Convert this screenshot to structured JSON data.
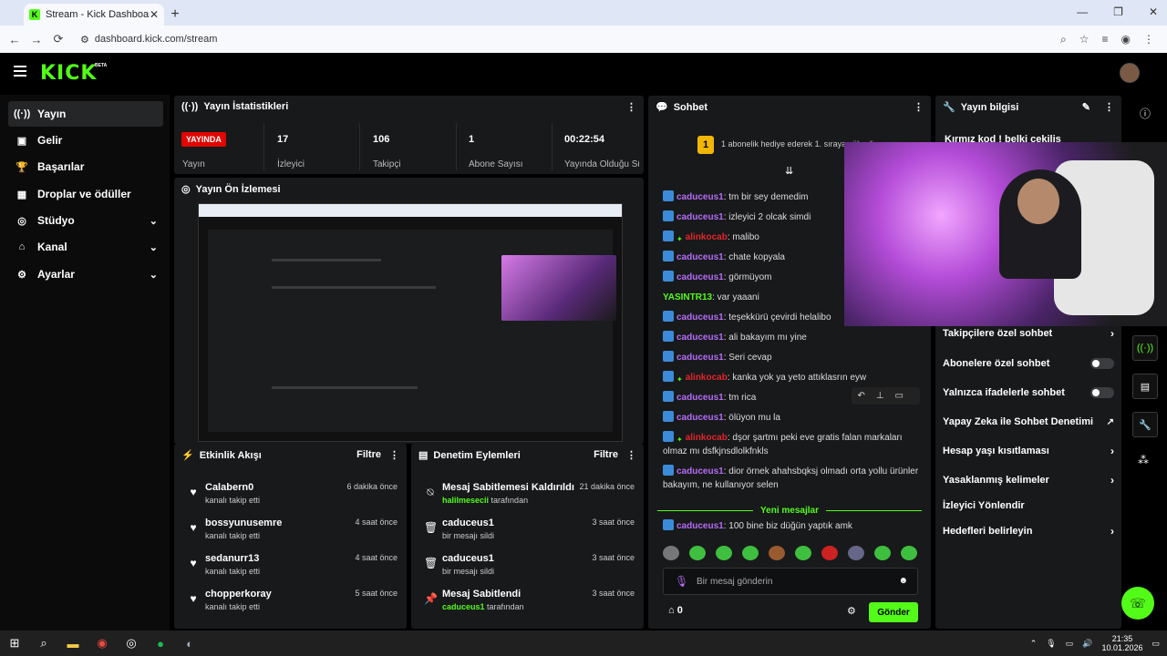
{
  "browser": {
    "tab_title": "Stream - Kick Dashboard",
    "url": "dashboard.kick.com/stream"
  },
  "header": {
    "logo": "KICK",
    "beta": "BETA"
  },
  "sidebar": {
    "items": [
      {
        "label": "Yayın",
        "icon": "broadcast-icon"
      },
      {
        "label": "Gelir",
        "icon": "revenue-icon"
      },
      {
        "label": "Başarılar",
        "icon": "trophy-icon"
      },
      {
        "label": "Droplar ve ödüller",
        "icon": "gift-icon"
      },
      {
        "label": "Stüdyo",
        "icon": "studio-icon"
      },
      {
        "label": "Kanal",
        "icon": "channel-icon"
      },
      {
        "label": "Ayarlar",
        "icon": "gear-icon"
      }
    ]
  },
  "stats": {
    "title": "Yayın İstatistikleri",
    "live": "YAYINDA",
    "stream_label": "Yayın",
    "viewers": "17",
    "viewers_label": "İzleyici",
    "followers": "106",
    "followers_label": "Takipçi",
    "subs": "1",
    "subs_label": "Abone Sayısı",
    "uptime": "00:22:54",
    "uptime_label": "Yayında Olduğu Süre"
  },
  "preview": {
    "title": "Yayın Ön İzlemesi"
  },
  "activity": {
    "title": "Etkinlik Akışı",
    "filter": "Filtre",
    "items": [
      {
        "name": "Calabern0",
        "sub": "kanalı takip etti",
        "time": "6 dakika önce"
      },
      {
        "name": "bossyunusemre",
        "sub": "kanalı takip etti",
        "time": "4 saat önce"
      },
      {
        "name": "sedanurr13",
        "sub": "kanalı takip etti",
        "time": "4 saat önce"
      },
      {
        "name": "chopperkoray",
        "sub": "kanalı takip etti",
        "time": "5 saat önce"
      }
    ]
  },
  "moderation": {
    "title": "Denetim Eylemleri",
    "filter": "Filtre",
    "items": [
      {
        "name": "Mesaj Sabitlemesi Kaldırıldı",
        "by": "halilmesecii",
        "sub": "tarafından",
        "time": "21 dakika önce"
      },
      {
        "name": "caduceus1",
        "sub": "bir mesajı sildi",
        "time": "3 saat önce"
      },
      {
        "name": "caduceus1",
        "sub": "bir mesajı sildi",
        "time": "3 saat önce"
      },
      {
        "name": "Mesaj Sabitlendi",
        "by": "caduceus1",
        "sub": "tarafından",
        "time": "3 saat önce"
      }
    ]
  },
  "chat": {
    "title": "Sohbet",
    "gift_banner": "1 abonelik hediye ederek 1. sıraya yükselin",
    "gift_rank": "1",
    "messages": [
      {
        "user": "caduceus1",
        "text": ": tm bir sey demedim"
      },
      {
        "user": "caduceus1",
        "text": ": izleyici 2 olcak simdi"
      },
      {
        "user": "alinkocab",
        "text": ": malibo"
      },
      {
        "user": "caduceus1",
        "text": ": chate kopyala"
      },
      {
        "user": "caduceus1",
        "text": ": görmüyom"
      },
      {
        "user": "YASINTR13",
        "text": ": var yaaani"
      },
      {
        "user": "caduceus1",
        "text": ": teşekkürü çevirdi helalibo"
      },
      {
        "user": "caduceus1",
        "text": ": ali bakayım mı yine"
      },
      {
        "user": "caduceus1",
        "text": ": Seri cevap"
      },
      {
        "user": "alinkocab",
        "text": ": kanka yok ya yeto attıklasrın eyw"
      },
      {
        "user": "caduceus1",
        "text": ": tm rica"
      },
      {
        "user": "caduceus1",
        "text": ": ölüyon mu la"
      },
      {
        "user": "alinkocab",
        "text": ": dşor şartmı peki eve gratis falan markaları olmaz mı dsfkjnsdlolkfnkls"
      },
      {
        "user": "caduceus1",
        "text": ": dior örnek ahahsbqksj olmadı orta yollu ürünler bakayım, ne kullanıyor selen"
      },
      {
        "user": "caduceus1",
        "text": ": 100 bine biz düğün yaptık amk"
      }
    ],
    "new_messages": "Yeni mesajlar",
    "placeholder": "Bir mesaj gönderin",
    "points": "0",
    "send": "Gönder"
  },
  "info": {
    "title": "Yayın bilgisi",
    "stream_title": "Kırmız kod ! belki çekiliş",
    "settings": [
      {
        "label": "Takipçilere özel sohbet",
        "control": "chevron"
      },
      {
        "label": "Abonelere özel sohbet",
        "control": "toggle"
      },
      {
        "label": "Yalnızca ifadelerle sohbet",
        "control": "toggle"
      },
      {
        "label": "Yapay Zeka ile Sohbet Denetimi",
        "control": "external"
      },
      {
        "label": "Hesap yaşı kısıtlaması",
        "control": "chevron"
      },
      {
        "label": "Yasaklanmış kelimeler",
        "control": "chevron"
      },
      {
        "label": "İzleyici Yönlendir",
        "control": "none"
      },
      {
        "label": "Hedefleri belirleyin",
        "control": "chevron"
      }
    ]
  },
  "taskbar": {
    "time": "21:35",
    "date": "10.01.2026"
  }
}
